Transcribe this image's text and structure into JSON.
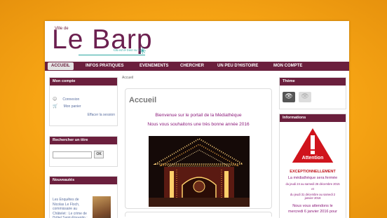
{
  "header": {
    "ville_label": "Ville de",
    "site_title": "Le Barp",
    "tagline": "Où est le bien vu ?"
  },
  "nav": {
    "items": [
      {
        "label": "ACCUEIL"
      },
      {
        "label": "INFOS PRATIQUES"
      },
      {
        "label": "EVENEMENTS"
      },
      {
        "label": "CHERCHER"
      },
      {
        "label": "UN PEU D'HISTOIRE"
      },
      {
        "label": "MON COMPTE"
      }
    ]
  },
  "left": {
    "account": {
      "title": "Mon compte",
      "connexion": "Connexion",
      "panier": "Mon panier",
      "clear_session": "Effacer la session"
    },
    "search": {
      "title": "Rechercher un titre",
      "button": "OK"
    },
    "news": {
      "title": "Nouveautés",
      "item_text": "Les Enquêtes de Nicolas Le Floch, commissaire au Châtelet : Le crime de l'hôtel Saint-Florentin : roman"
    }
  },
  "center": {
    "breadcrumb": "Accueil",
    "title": "Accueil",
    "welcome_line1": "Bienvenue sur le portail de la Médiathèque",
    "welcome_line2": "Nous vous souhaitons une très bonne année 2016"
  },
  "right": {
    "theme": {
      "title": "Thème"
    },
    "info": {
      "title": "Informations",
      "attention": "Attention",
      "exceptionally": "EXCEPTIONNELLEMENT",
      "closed": "La médiathèque sera fermée",
      "dates1": "du jeudi 24 au samedi 26 décembre 2015",
      "et": "et",
      "dates2": "du jeudi 31 décembre au samedi 2 janvier 2016",
      "await1": "Nous vous attendons le",
      "await2": "mercredi 6 janvier 2016 pour"
    }
  },
  "colors": {
    "background": "#f7a514",
    "brand": "#6b1f3d",
    "accent": "#2aa7a0",
    "welcome_text": "#8b1a7a",
    "warning": "#d0141c"
  }
}
